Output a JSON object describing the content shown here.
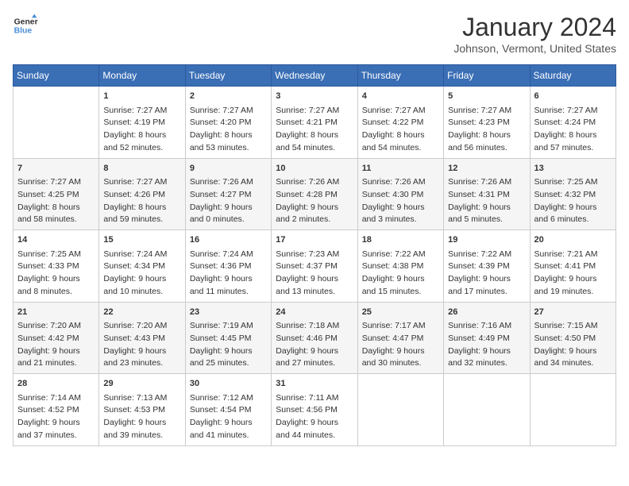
{
  "header": {
    "logo_line1": "General",
    "logo_line2": "Blue",
    "month": "January 2024",
    "location": "Johnson, Vermont, United States"
  },
  "weekdays": [
    "Sunday",
    "Monday",
    "Tuesday",
    "Wednesday",
    "Thursday",
    "Friday",
    "Saturday"
  ],
  "weeks": [
    [
      {
        "date": "",
        "content": ""
      },
      {
        "date": "1",
        "content": "Sunrise: 7:27 AM\nSunset: 4:19 PM\nDaylight: 8 hours\nand 52 minutes."
      },
      {
        "date": "2",
        "content": "Sunrise: 7:27 AM\nSunset: 4:20 PM\nDaylight: 8 hours\nand 53 minutes."
      },
      {
        "date": "3",
        "content": "Sunrise: 7:27 AM\nSunset: 4:21 PM\nDaylight: 8 hours\nand 54 minutes."
      },
      {
        "date": "4",
        "content": "Sunrise: 7:27 AM\nSunset: 4:22 PM\nDaylight: 8 hours\nand 54 minutes."
      },
      {
        "date": "5",
        "content": "Sunrise: 7:27 AM\nSunset: 4:23 PM\nDaylight: 8 hours\nand 56 minutes."
      },
      {
        "date": "6",
        "content": "Sunrise: 7:27 AM\nSunset: 4:24 PM\nDaylight: 8 hours\nand 57 minutes."
      }
    ],
    [
      {
        "date": "7",
        "content": "Sunrise: 7:27 AM\nSunset: 4:25 PM\nDaylight: 8 hours\nand 58 minutes."
      },
      {
        "date": "8",
        "content": "Sunrise: 7:27 AM\nSunset: 4:26 PM\nDaylight: 8 hours\nand 59 minutes."
      },
      {
        "date": "9",
        "content": "Sunrise: 7:26 AM\nSunset: 4:27 PM\nDaylight: 9 hours\nand 0 minutes."
      },
      {
        "date": "10",
        "content": "Sunrise: 7:26 AM\nSunset: 4:28 PM\nDaylight: 9 hours\nand 2 minutes."
      },
      {
        "date": "11",
        "content": "Sunrise: 7:26 AM\nSunset: 4:30 PM\nDaylight: 9 hours\nand 3 minutes."
      },
      {
        "date": "12",
        "content": "Sunrise: 7:26 AM\nSunset: 4:31 PM\nDaylight: 9 hours\nand 5 minutes."
      },
      {
        "date": "13",
        "content": "Sunrise: 7:25 AM\nSunset: 4:32 PM\nDaylight: 9 hours\nand 6 minutes."
      }
    ],
    [
      {
        "date": "14",
        "content": "Sunrise: 7:25 AM\nSunset: 4:33 PM\nDaylight: 9 hours\nand 8 minutes."
      },
      {
        "date": "15",
        "content": "Sunrise: 7:24 AM\nSunset: 4:34 PM\nDaylight: 9 hours\nand 10 minutes."
      },
      {
        "date": "16",
        "content": "Sunrise: 7:24 AM\nSunset: 4:36 PM\nDaylight: 9 hours\nand 11 minutes."
      },
      {
        "date": "17",
        "content": "Sunrise: 7:23 AM\nSunset: 4:37 PM\nDaylight: 9 hours\nand 13 minutes."
      },
      {
        "date": "18",
        "content": "Sunrise: 7:22 AM\nSunset: 4:38 PM\nDaylight: 9 hours\nand 15 minutes."
      },
      {
        "date": "19",
        "content": "Sunrise: 7:22 AM\nSunset: 4:39 PM\nDaylight: 9 hours\nand 17 minutes."
      },
      {
        "date": "20",
        "content": "Sunrise: 7:21 AM\nSunset: 4:41 PM\nDaylight: 9 hours\nand 19 minutes."
      }
    ],
    [
      {
        "date": "21",
        "content": "Sunrise: 7:20 AM\nSunset: 4:42 PM\nDaylight: 9 hours\nand 21 minutes."
      },
      {
        "date": "22",
        "content": "Sunrise: 7:20 AM\nSunset: 4:43 PM\nDaylight: 9 hours\nand 23 minutes."
      },
      {
        "date": "23",
        "content": "Sunrise: 7:19 AM\nSunset: 4:45 PM\nDaylight: 9 hours\nand 25 minutes."
      },
      {
        "date": "24",
        "content": "Sunrise: 7:18 AM\nSunset: 4:46 PM\nDaylight: 9 hours\nand 27 minutes."
      },
      {
        "date": "25",
        "content": "Sunrise: 7:17 AM\nSunset: 4:47 PM\nDaylight: 9 hours\nand 30 minutes."
      },
      {
        "date": "26",
        "content": "Sunrise: 7:16 AM\nSunset: 4:49 PM\nDaylight: 9 hours\nand 32 minutes."
      },
      {
        "date": "27",
        "content": "Sunrise: 7:15 AM\nSunset: 4:50 PM\nDaylight: 9 hours\nand 34 minutes."
      }
    ],
    [
      {
        "date": "28",
        "content": "Sunrise: 7:14 AM\nSunset: 4:52 PM\nDaylight: 9 hours\nand 37 minutes."
      },
      {
        "date": "29",
        "content": "Sunrise: 7:13 AM\nSunset: 4:53 PM\nDaylight: 9 hours\nand 39 minutes."
      },
      {
        "date": "30",
        "content": "Sunrise: 7:12 AM\nSunset: 4:54 PM\nDaylight: 9 hours\nand 41 minutes."
      },
      {
        "date": "31",
        "content": "Sunrise: 7:11 AM\nSunset: 4:56 PM\nDaylight: 9 hours\nand 44 minutes."
      },
      {
        "date": "",
        "content": ""
      },
      {
        "date": "",
        "content": ""
      },
      {
        "date": "",
        "content": ""
      }
    ]
  ]
}
